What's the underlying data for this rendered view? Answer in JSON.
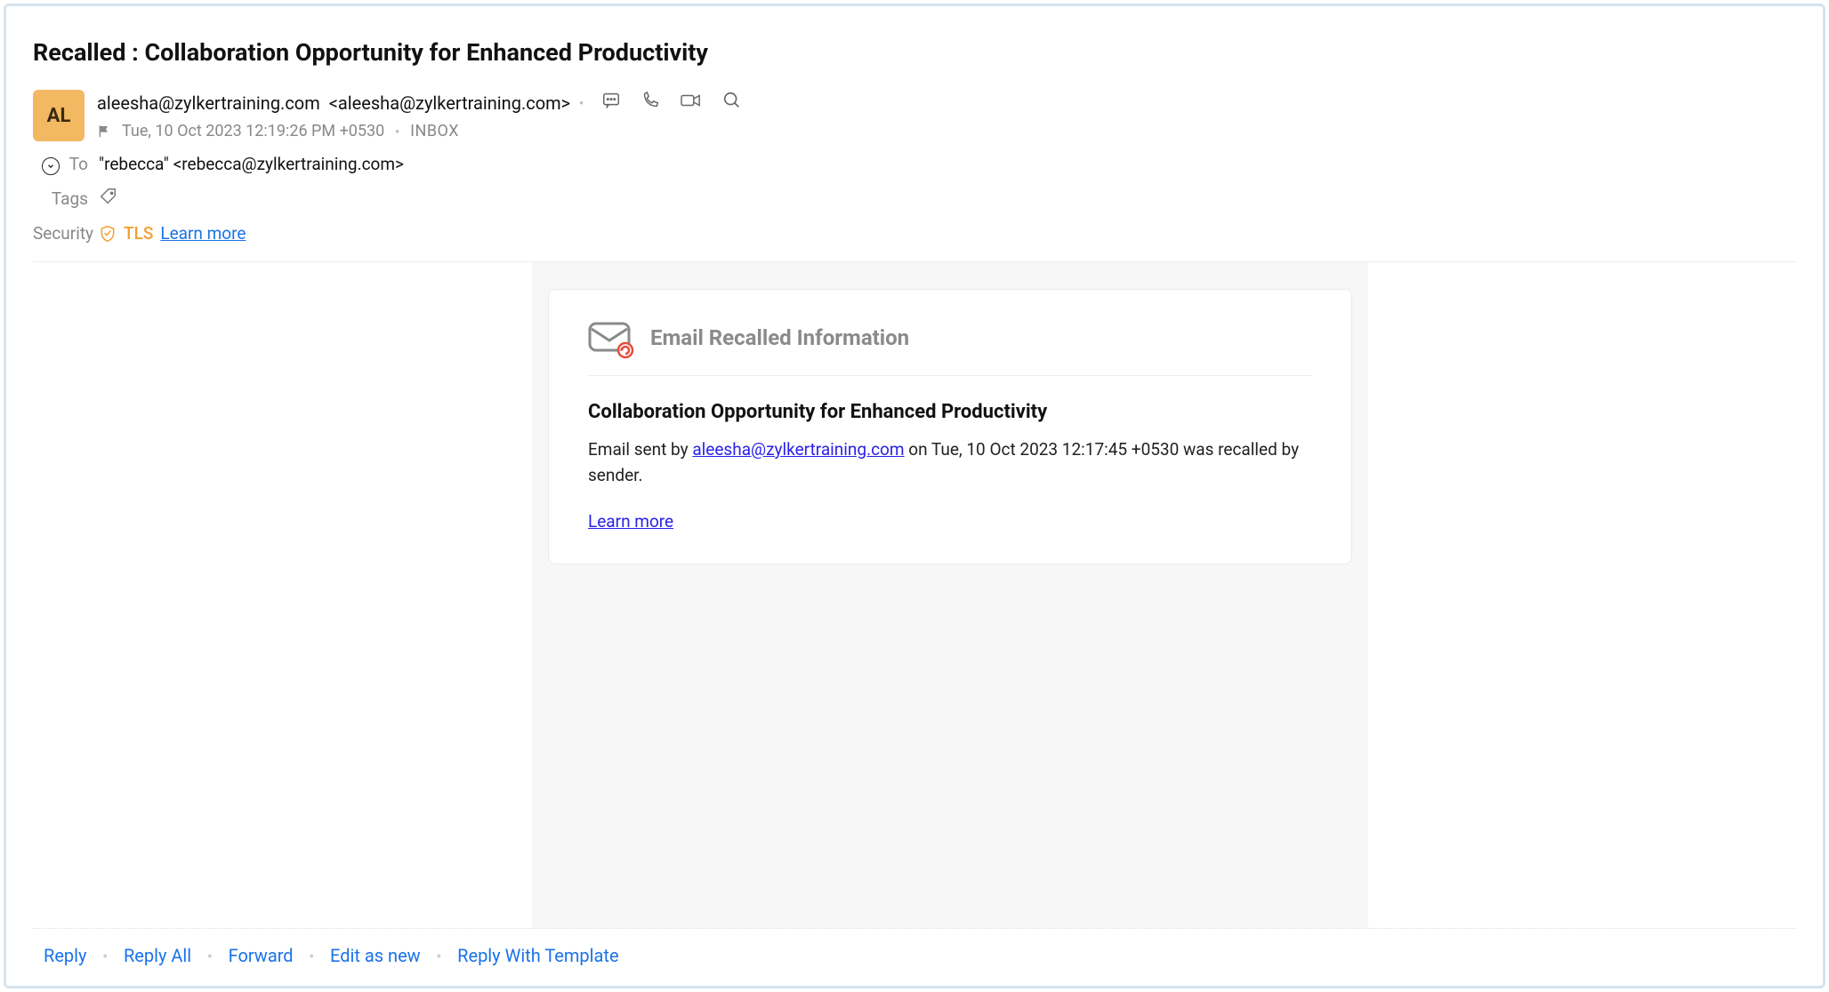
{
  "subject": "Recalled : Collaboration Opportunity for Enhanced Productivity",
  "avatar_initials": "AL",
  "from": {
    "display": "aleesha@zylkertraining.com",
    "address": "<aleesha@zylkertraining.com>"
  },
  "date": "Tue, 10 Oct 2023 12:19:26 PM +0530",
  "folder": "INBOX",
  "to": {
    "label": "To",
    "value": "\"rebecca\" <rebecca@zylkertraining.com>"
  },
  "tags_label": "Tags",
  "security": {
    "label": "Security",
    "tls": "TLS",
    "learn_more": "Learn more"
  },
  "recall_card": {
    "heading": "Email Recalled Information",
    "original_subject": "Collaboration Opportunity for Enhanced Productivity",
    "body_prefix": "Email sent by ",
    "sender_link": "aleesha@zylkertraining.com",
    "body_mid": " on Tue, 10 Oct 2023 12:17:45 +0530 was recalled by sender.",
    "learn_more": "Learn more"
  },
  "actions": {
    "reply": "Reply",
    "reply_all": "Reply All",
    "forward": "Forward",
    "edit_as_new": "Edit as new",
    "reply_with_template": "Reply With Template"
  }
}
